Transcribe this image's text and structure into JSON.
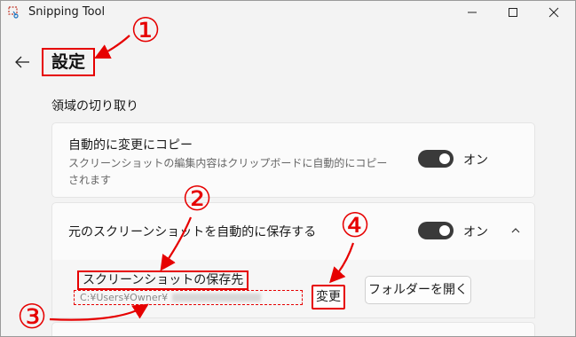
{
  "window": {
    "title": "Snipping Tool"
  },
  "page": {
    "title": "設定"
  },
  "section": {
    "label": "領域の切り取り"
  },
  "settings": {
    "auto_copy": {
      "title": "自動的に変更にコピー",
      "description": "スクリーンショットの編集内容はクリップボードに自動的にコピーされます",
      "toggle_label": "オン",
      "enabled": true
    },
    "auto_save": {
      "title": "元のスクリーンショットを自動的に保存する",
      "toggle_label": "オン",
      "enabled": true,
      "folder_label": "スクリーンショットの保存先",
      "folder_path": "C:¥Users¥Owner¥",
      "change_button": "変更",
      "open_folder_button": "フォルダーを開く"
    }
  },
  "annotations": [
    "①",
    "②",
    "③",
    "④"
  ],
  "colors": {
    "annotation": "#e60000",
    "toggle_on": "#3a3a3a",
    "background": "#f3f3f3"
  },
  "icons": [
    "snipping-tool-icon",
    "minimize-icon",
    "maximize-icon",
    "close-icon",
    "back-arrow-icon",
    "chevron-up-icon"
  ]
}
